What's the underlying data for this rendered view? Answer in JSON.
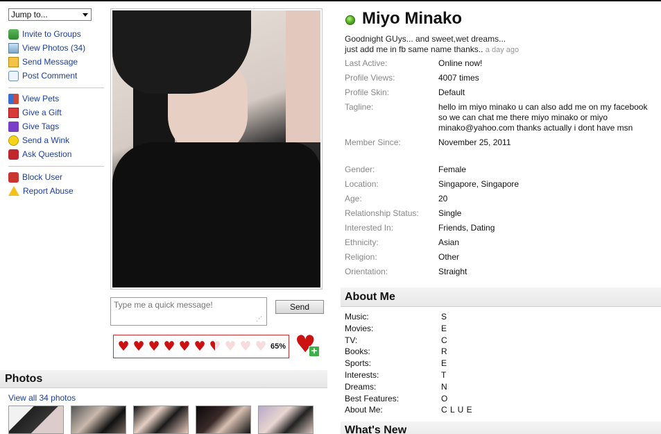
{
  "jump_menu": {
    "selected": "Jump to..."
  },
  "actions": [
    {
      "label": "Invite to Groups",
      "icon": "invite-groups-icon"
    },
    {
      "label": "View Photos (34)",
      "icon": "photos-icon"
    },
    {
      "label": "Send Message",
      "icon": "envelope-icon"
    },
    {
      "label": "Post Comment",
      "icon": "comment-icon"
    },
    {
      "label": "View Pets",
      "icon": "pets-icon"
    },
    {
      "label": "Give a Gift",
      "icon": "gift-icon"
    },
    {
      "label": "Give Tags",
      "icon": "star-tag-icon"
    },
    {
      "label": "Send a Wink",
      "icon": "wink-smiley-icon"
    },
    {
      "label": "Ask Question",
      "icon": "question-icon"
    },
    {
      "label": "Block User",
      "icon": "block-icon"
    },
    {
      "label": "Report Abuse",
      "icon": "warning-icon"
    }
  ],
  "quick_message": {
    "placeholder": "Type me a quick message!",
    "send_label": "Send"
  },
  "hearts": {
    "full": 6,
    "half": 1,
    "empty": 3,
    "percent_label": "65%"
  },
  "photos": {
    "title": "Photos",
    "view_all": "View all 34 photos",
    "thumb_count": 5
  },
  "profile": {
    "name": "Miyo Minako",
    "status_lines": [
      "Goodnight GUys... and sweet,wet dreams...",
      "just add me in fb same name thanks.."
    ],
    "status_time": "a day ago",
    "details": [
      {
        "k": "Last Active:",
        "v": "Online now!"
      },
      {
        "k": "Profile Views:",
        "v": "4007 times"
      },
      {
        "k": "Profile Skin:",
        "v": "Default"
      },
      {
        "k": "Tagline:",
        "v": "hello im miyo minako u can also add me on my facebook so we can chat me there miyo minako or miyo minako@yahoo.com thanks actually i dont have msn"
      },
      {
        "k": "Member Since:",
        "v": "November 25, 2011"
      }
    ],
    "basics": [
      {
        "k": "Gender:",
        "v": "Female"
      },
      {
        "k": "Location:",
        "v": "Singapore, Singapore"
      },
      {
        "k": "Age:",
        "v": "20"
      },
      {
        "k": "Relationship Status:",
        "v": "Single"
      },
      {
        "k": "Interested In:",
        "v": "Friends, Dating"
      },
      {
        "k": "Ethnicity:",
        "v": "Asian"
      },
      {
        "k": "Religion:",
        "v": "Other"
      },
      {
        "k": "Orientation:",
        "v": "Straight"
      }
    ]
  },
  "about": {
    "title": "About Me",
    "rows": [
      {
        "k": "Music:",
        "v": "S"
      },
      {
        "k": "Movies:",
        "v": "E"
      },
      {
        "k": "TV:",
        "v": "C"
      },
      {
        "k": "Books:",
        "v": "R"
      },
      {
        "k": "Sports:",
        "v": "E"
      },
      {
        "k": "Interests:",
        "v": "T"
      },
      {
        "k": "Dreams:",
        "v": "N"
      },
      {
        "k": "Best Features:",
        "v": "O"
      },
      {
        "k": "About Me:",
        "v": "C L U E"
      }
    ]
  },
  "whats_new": {
    "title": "What's New"
  },
  "colors": {
    "link": "#1a3e9e",
    "label_grey": "#888888",
    "heart_red": "#cc1111",
    "online_green": "#5bb52a"
  }
}
